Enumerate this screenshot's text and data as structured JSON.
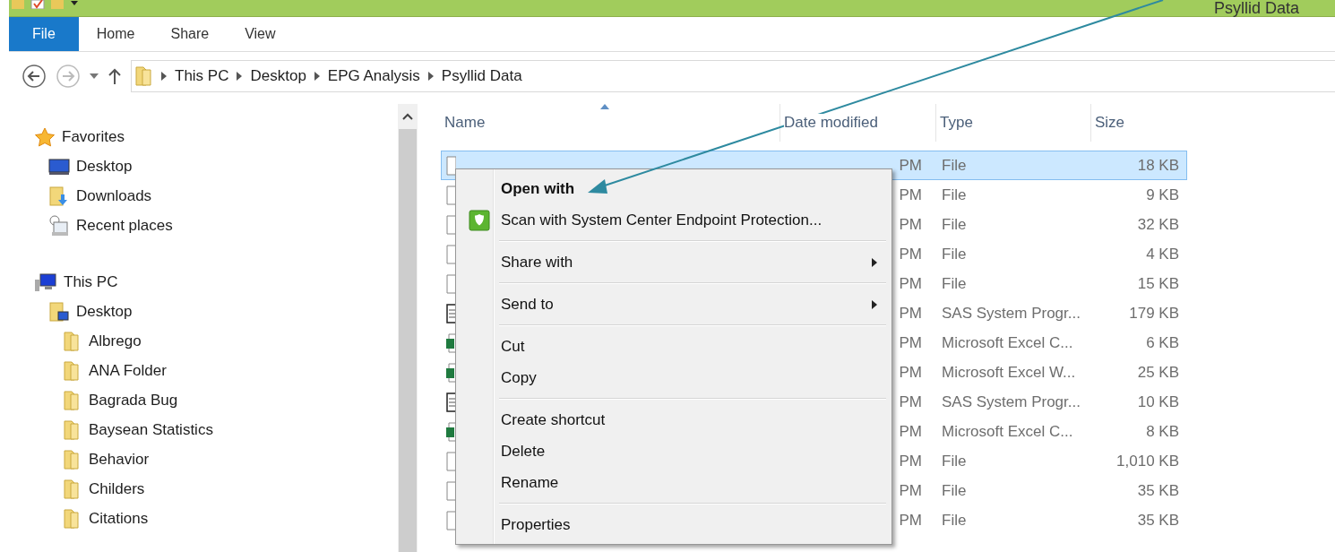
{
  "window": {
    "title": "Psyllid Data"
  },
  "ribbon_tabs": [
    {
      "label": "File",
      "selected": true
    },
    {
      "label": "Home",
      "selected": false
    },
    {
      "label": "Share",
      "selected": false
    },
    {
      "label": "View",
      "selected": false
    }
  ],
  "breadcrumb": [
    "This PC",
    "Desktop",
    "EPG Analysis",
    "Psyllid Data"
  ],
  "sidebar": {
    "sections": [
      {
        "label": "Favorites",
        "kind": "star",
        "children": [
          {
            "label": "Desktop",
            "kind": "monitor"
          },
          {
            "label": "Downloads",
            "kind": "downloads"
          },
          {
            "label": "Recent places",
            "kind": "recent"
          }
        ]
      },
      {
        "label": "This PC",
        "kind": "pc",
        "children": [
          {
            "label": "Desktop",
            "kind": "desktop",
            "children": [
              {
                "label": "Albrego",
                "kind": "folder"
              },
              {
                "label": "ANA Folder",
                "kind": "folder"
              },
              {
                "label": "Bagrada Bug",
                "kind": "folder"
              },
              {
                "label": "Baysean Statistics",
                "kind": "folder"
              },
              {
                "label": "Behavior",
                "kind": "folder"
              },
              {
                "label": "Childers",
                "kind": "folder"
              },
              {
                "label": "Citations",
                "kind": "folder"
              }
            ]
          }
        ]
      }
    ]
  },
  "table": {
    "columns": [
      "Name",
      "Date modified",
      "Type",
      "Size"
    ],
    "rows": [
      {
        "kind": "file",
        "date": "PM",
        "type": "File",
        "size": "18 KB",
        "selected": true
      },
      {
        "kind": "file",
        "date": "PM",
        "type": "File",
        "size": "9 KB",
        "selected": false
      },
      {
        "kind": "file",
        "date": "PM",
        "type": "File",
        "size": "32 KB",
        "selected": false
      },
      {
        "kind": "file",
        "date": "PM",
        "type": "File",
        "size": "4 KB",
        "selected": false
      },
      {
        "kind": "file",
        "date": "PM",
        "type": "File",
        "size": "15 KB",
        "selected": false
      },
      {
        "kind": "sas",
        "date": "PM",
        "type": "SAS System Progr...",
        "size": "179 KB",
        "selected": false
      },
      {
        "kind": "excel",
        "date": "PM",
        "type": "Microsoft Excel C...",
        "size": "6 KB",
        "selected": false
      },
      {
        "kind": "excel",
        "date": "PM",
        "type": "Microsoft Excel W...",
        "size": "25 KB",
        "selected": false
      },
      {
        "kind": "sas",
        "date": "PM",
        "type": "SAS System Progr...",
        "size": "10 KB",
        "selected": false
      },
      {
        "kind": "excel",
        "date": "PM",
        "type": "Microsoft Excel C...",
        "size": "8 KB",
        "selected": false
      },
      {
        "kind": "file",
        "date": "PM",
        "type": "File",
        "size": "1,010 KB",
        "selected": false
      },
      {
        "kind": "file",
        "date": "PM",
        "type": "File",
        "size": "35 KB",
        "selected": false
      },
      {
        "kind": "file",
        "date": "PM",
        "type": "File",
        "size": "35 KB",
        "selected": false
      }
    ]
  },
  "context_menu": [
    {
      "kind": "item",
      "label": "Open with",
      "default": true,
      "has_icon": false,
      "submenu": false
    },
    {
      "kind": "item",
      "label": "Scan with System Center Endpoint Protection...",
      "default": false,
      "has_icon": true,
      "submenu": false
    },
    {
      "kind": "separator"
    },
    {
      "kind": "item",
      "label": "Share with",
      "default": false,
      "has_icon": false,
      "submenu": true
    },
    {
      "kind": "separator"
    },
    {
      "kind": "item",
      "label": "Send to",
      "default": false,
      "has_icon": false,
      "submenu": true
    },
    {
      "kind": "separator"
    },
    {
      "kind": "item",
      "label": "Cut",
      "default": false,
      "has_icon": false,
      "submenu": false
    },
    {
      "kind": "item",
      "label": "Copy",
      "default": false,
      "has_icon": false,
      "submenu": false
    },
    {
      "kind": "separator"
    },
    {
      "kind": "item",
      "label": "Create shortcut",
      "default": false,
      "has_icon": false,
      "submenu": false
    },
    {
      "kind": "item",
      "label": "Delete",
      "default": false,
      "has_icon": false,
      "submenu": false
    },
    {
      "kind": "item",
      "label": "Rename",
      "default": false,
      "has_icon": false,
      "submenu": false
    },
    {
      "kind": "separator"
    },
    {
      "kind": "item",
      "label": "Properties",
      "default": false,
      "has_icon": false,
      "submenu": false
    }
  ]
}
